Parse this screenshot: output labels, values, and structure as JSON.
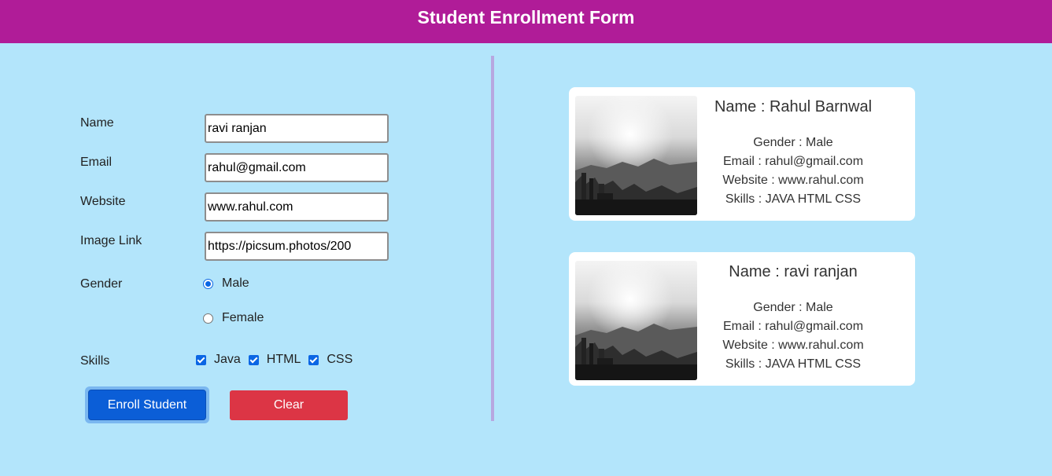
{
  "header": {
    "title": "Student Enrollment Form"
  },
  "colors": {
    "header_bg": "#b01c98",
    "page_bg": "#b3e5fb",
    "primary": "#0b5ed7",
    "danger": "#dc3545"
  },
  "form": {
    "name": {
      "label": "Name",
      "value": "ravi ranjan"
    },
    "email": {
      "label": "Email",
      "value": "rahul@gmail.com"
    },
    "website": {
      "label": "Website",
      "value": "www.rahul.com"
    },
    "image_link": {
      "label": "Image Link",
      "value": "https://picsum.photos/200"
    },
    "gender": {
      "label": "Gender",
      "options": [
        {
          "label": "Male",
          "checked": true
        },
        {
          "label": "Female",
          "checked": false
        }
      ]
    },
    "skills": {
      "label": "Skills",
      "options": [
        {
          "label": "Java",
          "checked": true
        },
        {
          "label": "HTML",
          "checked": true
        },
        {
          "label": "CSS",
          "checked": true
        }
      ]
    },
    "enroll_button": "Enroll Student",
    "clear_button": "Clear"
  },
  "cards": [
    {
      "name": "Name : Rahul Barnwal",
      "gender": "Gender : Male",
      "email": "Email : rahul@gmail.com",
      "website": "Website : www.rahul.com",
      "skills": "Skills : JAVA HTML CSS",
      "image_icon": "city-skyline-photo"
    },
    {
      "name": "Name : ravi ranjan",
      "gender": "Gender : Male",
      "email": "Email : rahul@gmail.com",
      "website": "Website : www.rahul.com",
      "skills": "Skills : JAVA HTML CSS",
      "image_icon": "city-skyline-photo"
    }
  ]
}
